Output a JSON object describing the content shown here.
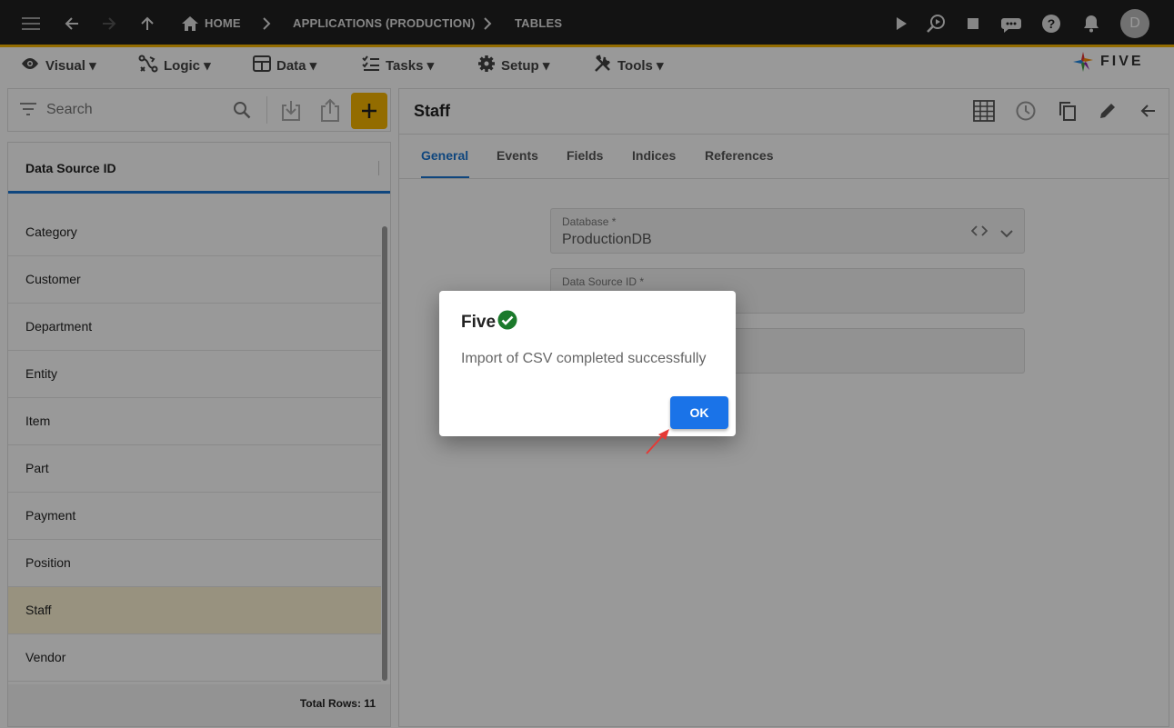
{
  "topbar": {
    "breadcrumbs": [
      "HOME",
      "APPLICATIONS (PRODUCTION)",
      "TABLES"
    ],
    "avatar_initial": "D",
    "icons": [
      "menu-icon",
      "back-arrow-icon",
      "forward-arrow-icon",
      "up-arrow-icon",
      "home-icon",
      "play-icon",
      "debug-search-icon",
      "stop-icon",
      "chat-bot-icon",
      "help-icon",
      "bell-icon"
    ]
  },
  "menubar": {
    "items": [
      {
        "label": "Visual ▾",
        "icon": "eye-icon"
      },
      {
        "label": "Logic ▾",
        "icon": "logic-icon"
      },
      {
        "label": "Data ▾",
        "icon": "table-icon"
      },
      {
        "label": "Tasks ▾",
        "icon": "checklist-icon"
      },
      {
        "label": "Setup ▾",
        "icon": "gear-icon"
      },
      {
        "label": "Tools ▾",
        "icon": "tools-icon"
      }
    ],
    "logo_text": "FIVE"
  },
  "search": {
    "placeholder": "Search"
  },
  "list": {
    "column_header": "Data Source ID",
    "rows": [
      "Category",
      "Customer",
      "Department",
      "Entity",
      "Item",
      "Part",
      "Payment",
      "Position",
      "Staff",
      "Vendor"
    ],
    "selected": "Staff",
    "footer": "Total Rows: 11"
  },
  "detail": {
    "title": "Staff",
    "tabs": [
      "General",
      "Events",
      "Fields",
      "Indices",
      "References"
    ],
    "active_tab": "General",
    "fields": [
      {
        "label": "Database *",
        "value": "ProductionDB"
      },
      {
        "label": "Data Source ID *",
        "value": ""
      },
      {
        "label": "",
        "value": ""
      }
    ]
  },
  "dialog": {
    "title": "Five",
    "message": "Import of CSV completed successfully",
    "ok_label": "OK"
  },
  "colors": {
    "topbar_bg": "#212121",
    "accent_yellow": "#f5b400",
    "primary_blue": "#1a73e8",
    "success_green": "#2e7d32"
  }
}
